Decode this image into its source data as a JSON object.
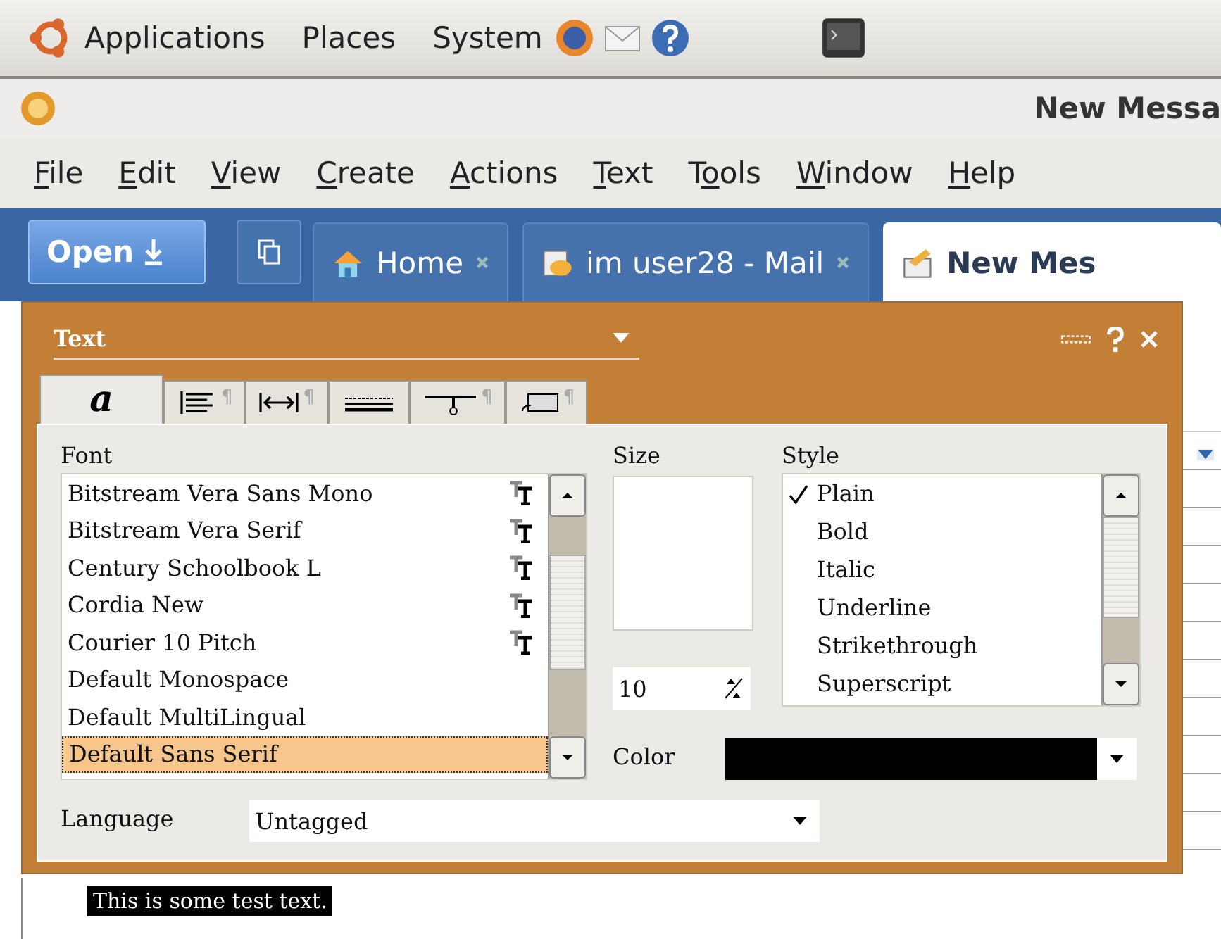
{
  "top_panel": {
    "menus": [
      "Applications",
      "Places",
      "System"
    ]
  },
  "window": {
    "title": "New Messa"
  },
  "menu_bar": [
    {
      "key": "F",
      "post": "ile"
    },
    {
      "key": "E",
      "post": "dit"
    },
    {
      "key": "V",
      "post": "iew"
    },
    {
      "key": "C",
      "post": "reate"
    },
    {
      "key": "A",
      "post": "ctions"
    },
    {
      "key": "T",
      "post": "ext"
    },
    {
      "pre": "T",
      "key": "o",
      "post": "ols"
    },
    {
      "key": "W",
      "post": "indow"
    },
    {
      "key": "H",
      "post": "elp"
    }
  ],
  "toolbar": {
    "open_button": "Open",
    "tabs": [
      {
        "kind": "home",
        "label": "Home",
        "selected": false
      },
      {
        "kind": "mail",
        "label": "im user28 - Mail",
        "selected": false
      },
      {
        "kind": "compose",
        "label": "New Mes",
        "selected": true
      }
    ]
  },
  "text_dialog": {
    "title": "Text",
    "tabs": [
      {
        "kind": "character",
        "label": "a",
        "selected": true
      },
      {
        "kind": "align",
        "mark": "¶",
        "selected": false
      },
      {
        "kind": "spacing",
        "mark": "¶",
        "selected": false
      },
      {
        "kind": "lines",
        "selected": false
      },
      {
        "kind": "tabs",
        "mark": "¶",
        "selected": false
      },
      {
        "kind": "border",
        "mark": "¶",
        "selected": false
      }
    ],
    "font": {
      "label": "Font",
      "items": [
        {
          "name": "Bitstream Vera Sans Mono",
          "truetype": true,
          "selected": false
        },
        {
          "name": "Bitstream Vera Serif",
          "truetype": true,
          "selected": false
        },
        {
          "name": "Century Schoolbook L",
          "truetype": true,
          "selected": false
        },
        {
          "name": "Cordia New",
          "truetype": true,
          "selected": false
        },
        {
          "name": "Courier 10 Pitch",
          "truetype": true,
          "selected": false
        },
        {
          "name": "Default Monospace",
          "truetype": false,
          "selected": false
        },
        {
          "name": "Default MultiLingual",
          "truetype": false,
          "selected": false
        },
        {
          "name": "Default Sans Serif",
          "truetype": false,
          "selected": true
        }
      ]
    },
    "size": {
      "label": "Size",
      "value": "10"
    },
    "style": {
      "label": "Style",
      "items": [
        {
          "name": "Plain",
          "checked": true
        },
        {
          "name": "Bold",
          "checked": false
        },
        {
          "name": "Italic",
          "checked": false
        },
        {
          "name": "Underline",
          "checked": false
        },
        {
          "name": "Strikethrough",
          "checked": false
        },
        {
          "name": "Superscript",
          "checked": false
        }
      ]
    },
    "color": {
      "label": "Color",
      "color": "#000000"
    },
    "language": {
      "label": "Language",
      "value": "Untagged"
    }
  },
  "editor": {
    "text": "This is some test text.",
    "selected": true
  }
}
